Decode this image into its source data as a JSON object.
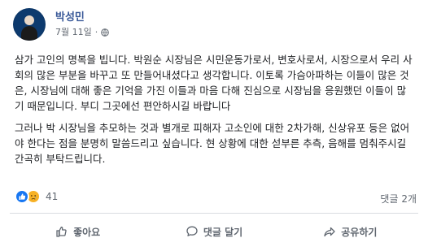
{
  "post": {
    "author": "박성민",
    "date": "7월 11일",
    "separator": "·",
    "privacy_icon": "globe-icon",
    "paragraphs": [
      "삼가 고인의 명복을 빕니다. 박원순 시장님은 시민운동가로서, 변호사로서, 시장으로서 우리 사회의 많은 부분을 바꾸고 또 만들어내셨다고 생각합니다. 이토록 가슴아파하는 이들이 많은 것은, 시장님에 대해 좋은 기억을 가진 이들과 마음 다해 진심으로 시장님을 응원했던 이들이 많기 때문입니다. 부디 그곳에선 편안하시길 바랍니다",
      "그러나 박 시장님을 추모하는 것과 별개로 피해자 고소인에 대한 2차가해, 신상유포 등은 없어야 한다는 점을 분명히 말씀드리고 싶습니다. 현 상황에 대한 섣부른 추측, 음해를 멈춰주시길 간곡히 부탁드립니다."
    ]
  },
  "reactions": {
    "icons": [
      "like-reaction-icon",
      "sad-reaction-icon"
    ],
    "count": "41"
  },
  "comments_count": "댓글 2개",
  "actions": {
    "like_label": "좋아요",
    "comment_label": "댓글 달기",
    "share_label": "공유하기"
  },
  "colors": {
    "author_link": "#385898",
    "like_blue": "#1877f2",
    "sad_yellow": "#f7b125",
    "muted": "#606770"
  }
}
